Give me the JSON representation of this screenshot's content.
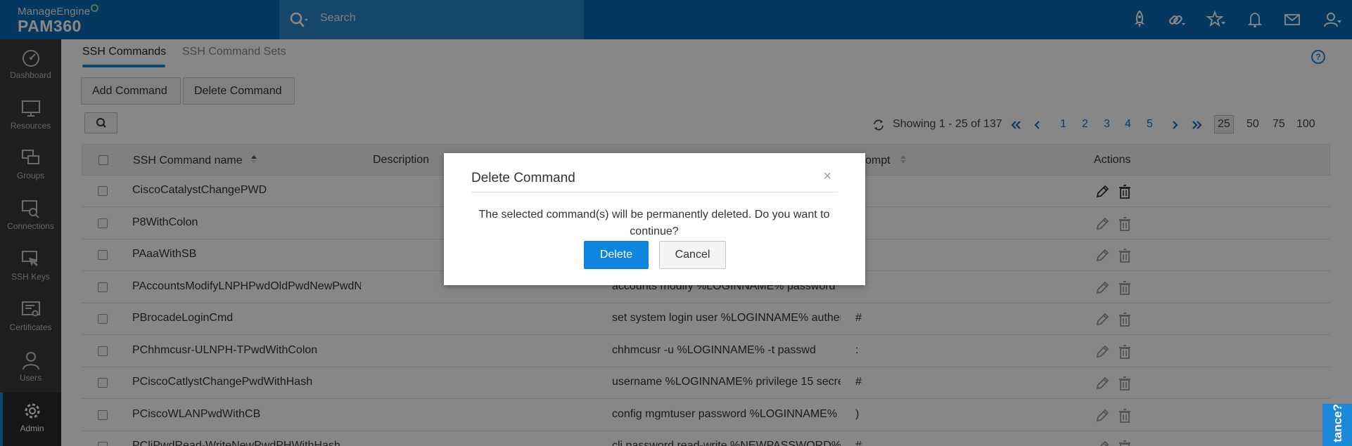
{
  "brand": {
    "company": "ManageEngine",
    "product": "PAM360"
  },
  "search": {
    "placeholder": "Search"
  },
  "header_icons": [
    "rocket-icon",
    "link-icon",
    "star-icon",
    "bell-icon",
    "mail-icon",
    "user-icon"
  ],
  "sidebar": {
    "items": [
      {
        "label": "Dashboard",
        "icon": "gauge-icon"
      },
      {
        "label": "Resources",
        "icon": "monitor-icon"
      },
      {
        "label": "Groups",
        "icon": "groups-icon"
      },
      {
        "label": "Connections",
        "icon": "connections-icon"
      },
      {
        "label": "SSH Keys",
        "icon": "ssh-key-icon"
      },
      {
        "label": "Certificates",
        "icon": "certificate-icon"
      },
      {
        "label": "Users",
        "icon": "user-icon"
      },
      {
        "label": "Admin",
        "icon": "gear-icon"
      }
    ],
    "active": "Admin"
  },
  "tabs": {
    "active": "SSH Commands",
    "inactive": "SSH Command Sets"
  },
  "help_label": "?",
  "toolbar": {
    "add_label": "Add Command",
    "delete_label": "Delete Command"
  },
  "pagination": {
    "showing": "Showing 1 - 25 of 137",
    "pages": [
      "1",
      "2",
      "3",
      "4",
      "5"
    ],
    "page_sizes": [
      "25",
      "50",
      "75",
      "100"
    ],
    "selected_page_size": "25"
  },
  "table": {
    "headers": {
      "name": "SSH Command name",
      "description": "Description",
      "prompt": "ompt",
      "actions": "Actions"
    },
    "rows": [
      {
        "name": "CiscoCatalystChangePWD",
        "command": "",
        "prompt": ""
      },
      {
        "name": "P8WithColon",
        "command": "",
        "prompt": ""
      },
      {
        "name": "PAaaWithSB",
        "command": "",
        "prompt": ""
      },
      {
        "name": "PAccountsModifyLNPHPwdOldPwdNewPwdN",
        "command": "accounts modify %LOGINNAME% password",
        "prompt": ""
      },
      {
        "name": "PBrocadeLoginCmd",
        "command": "set system login user %LOGINNAME% authen",
        "prompt": "#"
      },
      {
        "name": "PChhmcusr-ULNPH-TPwdWithColon",
        "command": "chhmcusr -u %LOGINNAME% -t passwd",
        "prompt": ":"
      },
      {
        "name": "PCiscoCatlystChangePwdWithHash",
        "command": "username %LOGINNAME% privilege 15 secre",
        "prompt": "#"
      },
      {
        "name": "PCiscoWLANPwdWithCB",
        "command": "config mgmtuser password %LOGINNAME%",
        "prompt": ")"
      },
      {
        "name": "PCliPwdRead-WriteNewPwdPHWithHash",
        "command": "cli password read-write %NEWPASSWORD%",
        "prompt": "#"
      }
    ]
  },
  "modal": {
    "title": "Delete Command",
    "close": "×",
    "message": "The selected command(s) will be permanently deleted. Do you want to continue?",
    "confirm_label": "Delete",
    "cancel_label": "Cancel"
  },
  "assist": {
    "label": "tance?"
  },
  "colors": {
    "header": "#0a6bb1",
    "accent": "#1c88d8",
    "sidebar": "#3a3a3a",
    "primary_button": "#0e86e0"
  }
}
